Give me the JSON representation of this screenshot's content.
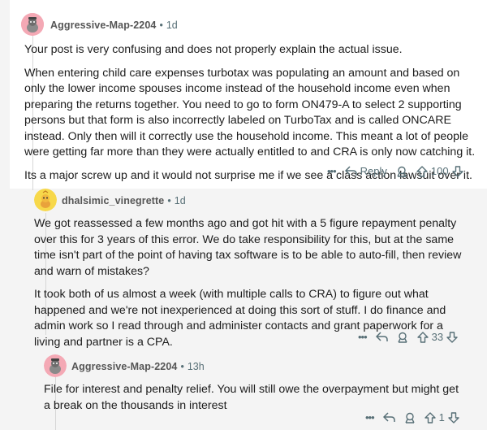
{
  "comments": [
    {
      "username": "Aggressive-Map-2204",
      "age": "1d",
      "paragraphs": [
        "Your post is very confusing and does not properly explain the actual issue.",
        "When entering child care expenses turbotax was populating an amount and based on only the lower income spouses income instead of the household income even when preparing the returns together.  You need to go to form ON479-A to select 2 supporting persons but that form is also incorrectly labeled on TurboTax and is called ONCARE instead.  Only then will it correctly use the household income.  This meant a lot of people were getting far more than they were actually entitled to and CRA is only now catching it.",
        "Its a major screw up and it would not surprise me if we see a class action lawsuit over it."
      ],
      "reply_label": "Reply",
      "score": "100",
      "avatar_color": "#f4a9b5"
    },
    {
      "username": "dhalsimic_vinegrette",
      "age": "1d",
      "paragraphs": [
        "We got reassessed a few months ago and got hit with a 5 figure repayment penalty over this for 3 years of this error. We do take responsibility for this, but at the same time isn't part of the point of having tax software is to be able to auto-fill, then review and warn of mistakes?",
        "It took both of us almost a week (with multiple calls to CRA) to figure out what happened and we're not inexperienced at doing this sort of stuff. I do finance and admin work so I read through and administer contacts and grant paperwork for a living and partner is a CPA."
      ],
      "score": "33",
      "avatar_color": "#f7d84a"
    },
    {
      "username": "Aggressive-Map-2204",
      "age": "13h",
      "paragraphs": [
        "File for interest and penalty relief.  You will still owe the overpayment but might get a break on the thousands in interest"
      ],
      "score": "1",
      "avatar_color": "#f4a9b5"
    }
  ],
  "separator": "•",
  "more": "•••",
  "colors": {
    "meta": "#576f76",
    "text": "#1c1c1c",
    "background": "#f4f4f4"
  }
}
